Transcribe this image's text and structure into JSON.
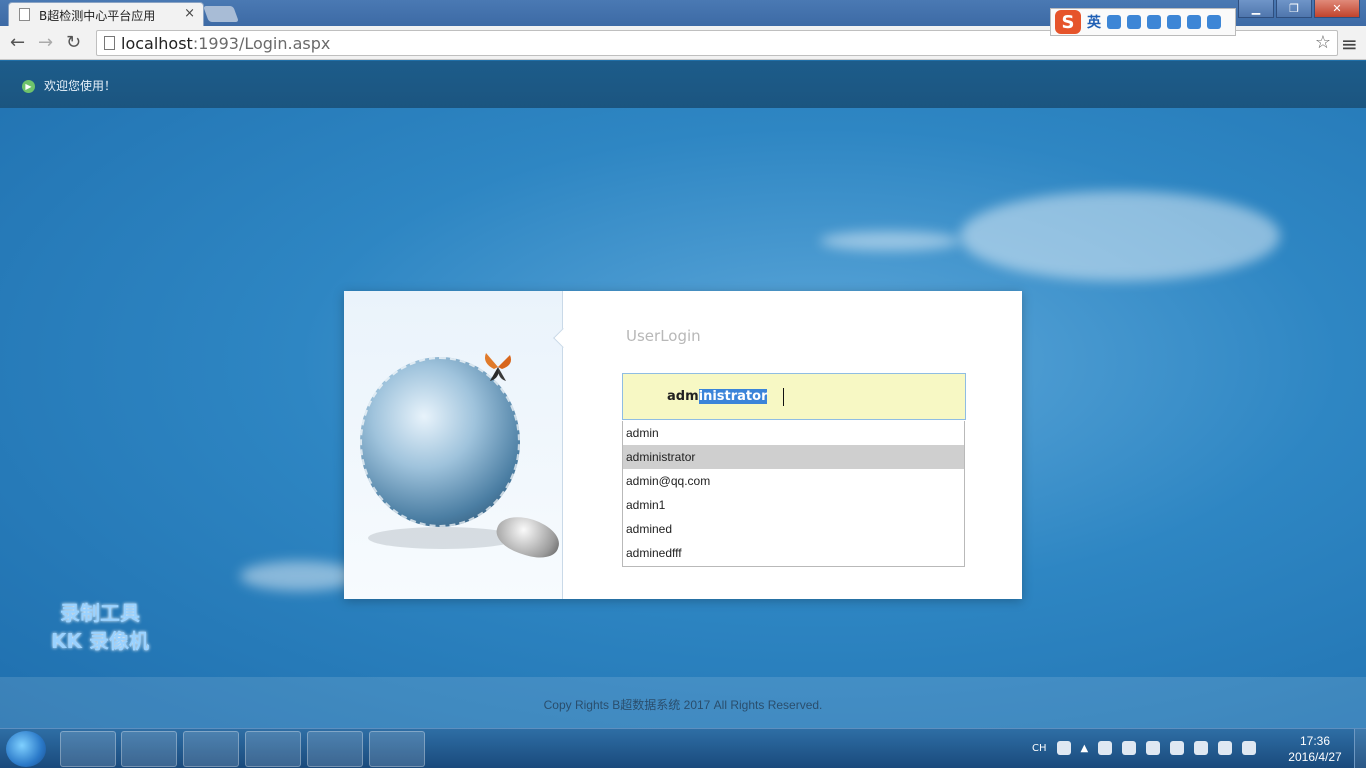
{
  "browser": {
    "tab_title": "B超检测中心平台应用",
    "tab_close": "×",
    "url_host": "localhost",
    "url_path": ":1993/Login.aspx",
    "ime_label": "英"
  },
  "page": {
    "welcome": "欢迎您使用！",
    "login_title": "UserLogin",
    "username_typed": "adm",
    "username_selected": "inistrator",
    "suggestions": [
      "admin",
      "administrator",
      "admin@qq.com",
      "admin1",
      "admined",
      "adminedfff"
    ],
    "selected_suggestion_index": 1,
    "footer": "Copy Rights B超数据系统 2017 All Rights Reserved."
  },
  "watermark": {
    "line1": "录制工具",
    "line2": "KK 录像机"
  },
  "taskbar": {
    "tray_lang": "CH",
    "time": "17:36",
    "date": "2016/4/27"
  },
  "colors": {
    "input_bg": "#f7f8c4",
    "selection": "#3b84d9",
    "active_suggestion": "#cfcfcf"
  }
}
